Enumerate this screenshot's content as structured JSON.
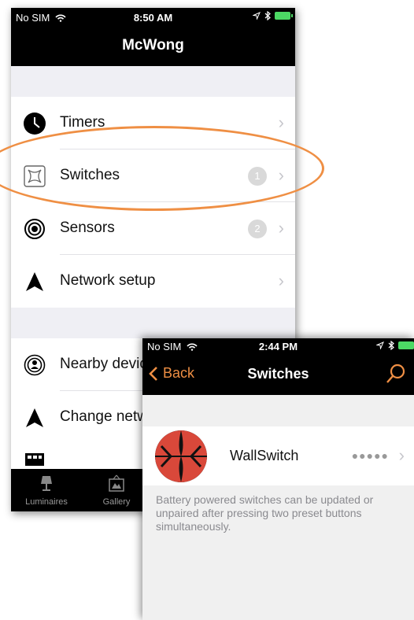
{
  "phone1": {
    "status": {
      "carrier": "No SIM",
      "time": "8:50 AM"
    },
    "nav_title": "McWong",
    "menu1": [
      {
        "label": "Timers",
        "icon": "clock-icon"
      },
      {
        "label": "Switches",
        "icon": "switch-icon",
        "badge": "1"
      },
      {
        "label": "Sensors",
        "icon": "sensor-icon",
        "badge": "2"
      },
      {
        "label": "Network setup",
        "icon": "network-icon"
      }
    ],
    "menu2": [
      {
        "label": "Nearby devic",
        "icon": "nearby-device-icon"
      },
      {
        "label": "Change netw",
        "icon": "change-network-icon"
      }
    ],
    "tabs": [
      {
        "label": "Luminaires",
        "icon": "lamp-icon"
      },
      {
        "label": "Gallery",
        "icon": "gallery-icon"
      }
    ]
  },
  "phone2": {
    "status": {
      "carrier": "No SIM",
      "time": "2:44 PM"
    },
    "back_label": "Back",
    "nav_title": "Switches",
    "device": {
      "name": "WallSwitch",
      "dots": "●●●●●"
    },
    "footer": "Battery powered switches can be updated or unpaired after pressing two preset buttons simultaneously."
  },
  "colors": {
    "accent": "#ef8f44",
    "highlight_ring": "#ef8f44",
    "logo_red": "#d9483a"
  }
}
